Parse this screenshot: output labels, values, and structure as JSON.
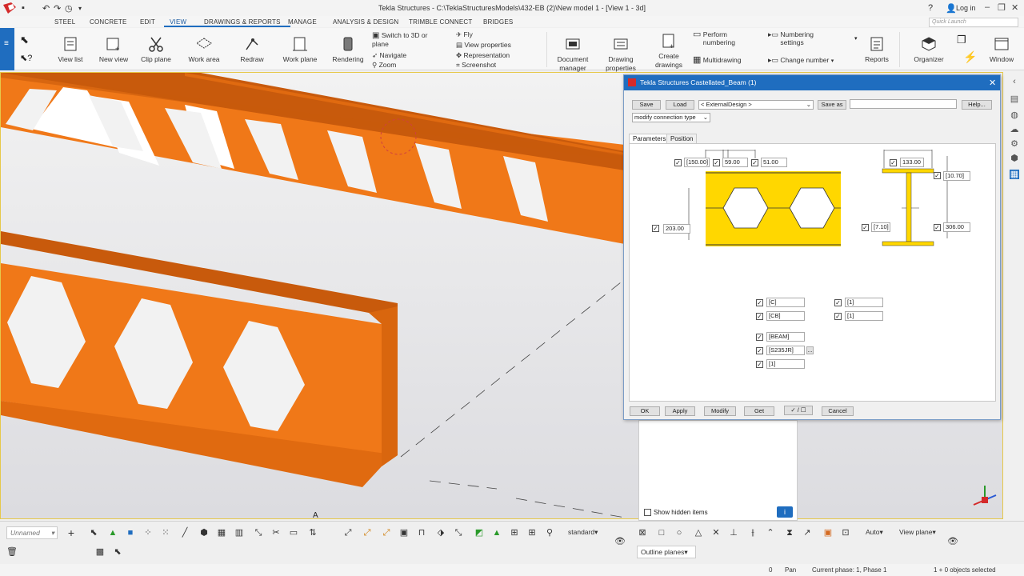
{
  "window": {
    "title": "Tekla Structures - C:\\TeklaStructuresModels\\432-EB (2)\\New model 1 - [View 1 - 3d]",
    "login": "Log in",
    "quick_launch_placeholder": "Quick Launch"
  },
  "menu": {
    "tabs": [
      "STEEL",
      "CONCRETE",
      "EDIT",
      "VIEW",
      "DRAWINGS & REPORTS",
      "MANAGE",
      "ANALYSIS & DESIGN",
      "TRIMBLE CONNECT",
      "BRIDGES"
    ],
    "active": "VIEW"
  },
  "ribbon": {
    "view_list": "View list",
    "new_view": "New view",
    "clip_plane": "Clip plane",
    "work_area": "Work area",
    "redraw": "Redraw",
    "work_plane": "Work plane",
    "rendering": "Rendering",
    "switch_3d": "Switch to 3D or plane",
    "navigate": "Navigate",
    "zoom": "Zoom",
    "fly": "Fly",
    "view_properties": "View properties",
    "representation": "Representation",
    "screenshot": "Screenshot",
    "document_manager": "Document manager",
    "drawing_properties": "Drawing properties",
    "create_drawings": "Create drawings",
    "perform_numbering": "Perform numbering",
    "multidrawing": "Multidrawing",
    "numbering_settings": "Numbering settings",
    "change_number": "Change number",
    "reports": "Reports",
    "organizer": "Organizer",
    "window": "Window"
  },
  "dialog": {
    "title": "Tekla Structures  Castellated_Beam (1)",
    "save": "Save",
    "load": "Load",
    "preset": "< ExternalDesign >",
    "save_as": "Save as",
    "save_as_value": "",
    "help": "Help...",
    "connection_type": "modify connection type",
    "tabs": [
      "Parameters",
      "Position"
    ],
    "active_tab": "Parameters",
    "params": {
      "hole_pitch": "[150.00]",
      "hole_width": "59.00",
      "hole_end": "51.00",
      "beam_depth": "203.00",
      "flange_width": "133.00",
      "flange_thickness": "[10.70]",
      "web_thickness": "[7.10]",
      "profile_depth": "306.00",
      "prefix1": "[C]",
      "prefix2": "[CB]",
      "start1": "[1]",
      "start2": "[1]",
      "name": "[BEAM]",
      "material": "[S235JR]",
      "class": "[1]",
      "material_browse": "..."
    },
    "ok": "OK",
    "apply": "Apply",
    "modify": "Modify",
    "get": "Get",
    "toggle": "✓ / ☐",
    "cancel": "Cancel"
  },
  "lower_panel": {
    "show_hidden": "Show hidden items"
  },
  "viewport": {
    "grid_label": "A"
  },
  "bottom": {
    "unnamed": "Unnamed",
    "standard": "standard",
    "auto": "Auto",
    "view_plane": "View plane",
    "outline_planes": "Outline planes"
  },
  "status": {
    "zero": "0",
    "pan": "Pan",
    "phase": "Current phase: 1, Phase 1",
    "selected": "1 + 0 objects selected"
  },
  "colors": {
    "beam_orange": "#f07818",
    "accent_blue": "#1f6dbf",
    "section_yellow": "#ffd700"
  }
}
